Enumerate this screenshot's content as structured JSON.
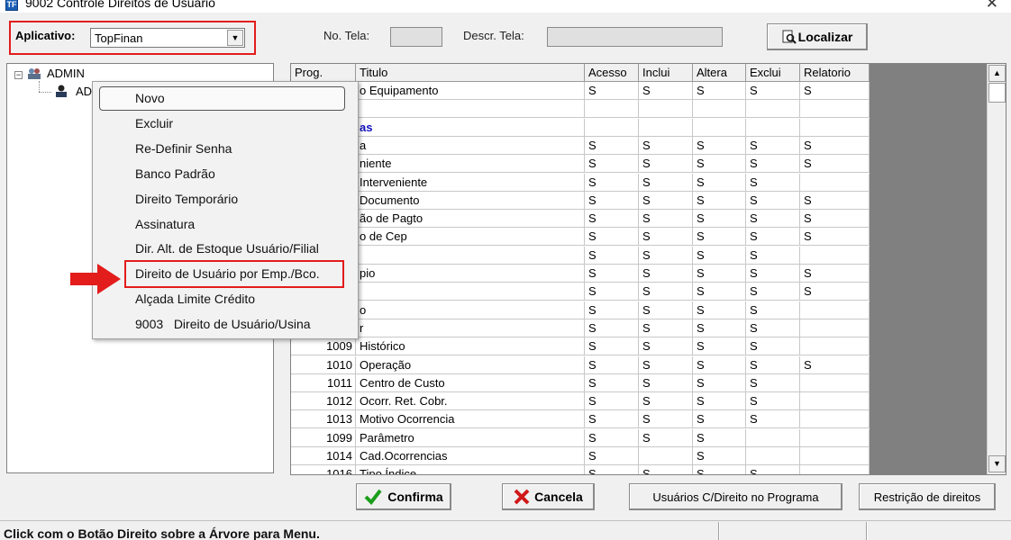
{
  "window": {
    "title": "9002 Controle Direitos de Usuário",
    "icon_label": "TF"
  },
  "top": {
    "aplicativo_label": "Aplicativo:",
    "aplicativo_value": "TopFinan",
    "no_tela_label": "No. Tela:",
    "descr_tela_label": "Descr. Tela:",
    "localizar_label": "Localizar"
  },
  "tree": {
    "root": "ADMIN",
    "child": "AD"
  },
  "grid": {
    "columns": [
      "Prog.",
      "Titulo",
      "Acesso",
      "Inclui",
      "Altera",
      "Exclui",
      "Relatorio"
    ],
    "rows": [
      {
        "prog": "",
        "titulo": "o Equipamento",
        "acesso": "S",
        "inclui": "S",
        "altera": "S",
        "exclui": "S",
        "relatorio": "S"
      },
      {
        "prog": "",
        "titulo": "",
        "acesso": "",
        "inclui": "",
        "altera": "",
        "exclui": "",
        "relatorio": ""
      },
      {
        "prog": "",
        "titulo": "as",
        "section": true,
        "acesso": "",
        "inclui": "",
        "altera": "",
        "exclui": "",
        "relatorio": ""
      },
      {
        "prog": "",
        "titulo": "a",
        "acesso": "S",
        "inclui": "S",
        "altera": "S",
        "exclui": "S",
        "relatorio": "S"
      },
      {
        "prog": "",
        "titulo": "niente",
        "acesso": "S",
        "inclui": "S",
        "altera": "S",
        "exclui": "S",
        "relatorio": "S"
      },
      {
        "prog": "",
        "titulo": "Interveniente",
        "acesso": "S",
        "inclui": "S",
        "altera": "S",
        "exclui": "S",
        "relatorio": ""
      },
      {
        "prog": "",
        "titulo": "Documento",
        "acesso": "S",
        "inclui": "S",
        "altera": "S",
        "exclui": "S",
        "relatorio": "S"
      },
      {
        "prog": "",
        "titulo": "ão de Pagto",
        "acesso": "S",
        "inclui": "S",
        "altera": "S",
        "exclui": "S",
        "relatorio": "S"
      },
      {
        "prog": "",
        "titulo": "o de Cep",
        "acesso": "S",
        "inclui": "S",
        "altera": "S",
        "exclui": "S",
        "relatorio": "S"
      },
      {
        "prog": "",
        "titulo": "",
        "acesso": "S",
        "inclui": "S",
        "altera": "S",
        "exclui": "S",
        "relatorio": ""
      },
      {
        "prog": "",
        "titulo": "pio",
        "acesso": "S",
        "inclui": "S",
        "altera": "S",
        "exclui": "S",
        "relatorio": "S"
      },
      {
        "prog": "",
        "titulo": "",
        "acesso": "S",
        "inclui": "S",
        "altera": "S",
        "exclui": "S",
        "relatorio": "S"
      },
      {
        "prog": "",
        "titulo": "o",
        "acesso": "S",
        "inclui": "S",
        "altera": "S",
        "exclui": "S",
        "relatorio": ""
      },
      {
        "prog": "",
        "titulo": "r",
        "acesso": "S",
        "inclui": "S",
        "altera": "S",
        "exclui": "S",
        "relatorio": ""
      },
      {
        "prog": "1009",
        "titulo": "Histórico",
        "acesso": "S",
        "inclui": "S",
        "altera": "S",
        "exclui": "S",
        "relatorio": ""
      },
      {
        "prog": "1010",
        "titulo": "Operação",
        "acesso": "S",
        "inclui": "S",
        "altera": "S",
        "exclui": "S",
        "relatorio": "S"
      },
      {
        "prog": "1011",
        "titulo": "Centro de Custo",
        "acesso": "S",
        "inclui": "S",
        "altera": "S",
        "exclui": "S",
        "relatorio": ""
      },
      {
        "prog": "1012",
        "titulo": "Ocorr. Ret. Cobr.",
        "acesso": "S",
        "inclui": "S",
        "altera": "S",
        "exclui": "S",
        "relatorio": ""
      },
      {
        "prog": "1013",
        "titulo": "Motivo Ocorrencia",
        "acesso": "S",
        "inclui": "S",
        "altera": "S",
        "exclui": "S",
        "relatorio": ""
      },
      {
        "prog": "1099",
        "titulo": "Parâmetro",
        "acesso": "S",
        "inclui": "S",
        "altera": "S",
        "exclui": "",
        "relatorio": ""
      },
      {
        "prog": "1014",
        "titulo": "Cad.Ocorrencias",
        "acesso": "S",
        "inclui": "",
        "altera": "S",
        "exclui": "",
        "relatorio": ""
      },
      {
        "prog": "1016",
        "titulo": "Tipo Índice",
        "acesso": "S",
        "inclui": "S",
        "altera": "S",
        "exclui": "S",
        "relatorio": ""
      }
    ]
  },
  "context_menu": {
    "items": [
      "Novo",
      "Excluir",
      "Re-Definir Senha",
      "Banco Padrão",
      "Direito Temporário",
      "Assinatura",
      "Dir. Alt. de Estoque Usuário/Filial",
      "Direito de Usuário por Emp./Bco.",
      "Alçada Limite Crédito",
      "9003   Direito de Usuário/Usina"
    ]
  },
  "buttons": {
    "confirma": "Confirma",
    "cancela": "Cancela",
    "usuarios": "Usuários C/Direito no Programa",
    "restricao": "Restrição de direitos"
  },
  "status": {
    "text": "Click com o Botão Direito sobre a Árvore para Menu."
  },
  "colors": {
    "highlight_red": "#e31c1c",
    "section_blue": "#1010c0",
    "grid_dark": "#808080"
  }
}
